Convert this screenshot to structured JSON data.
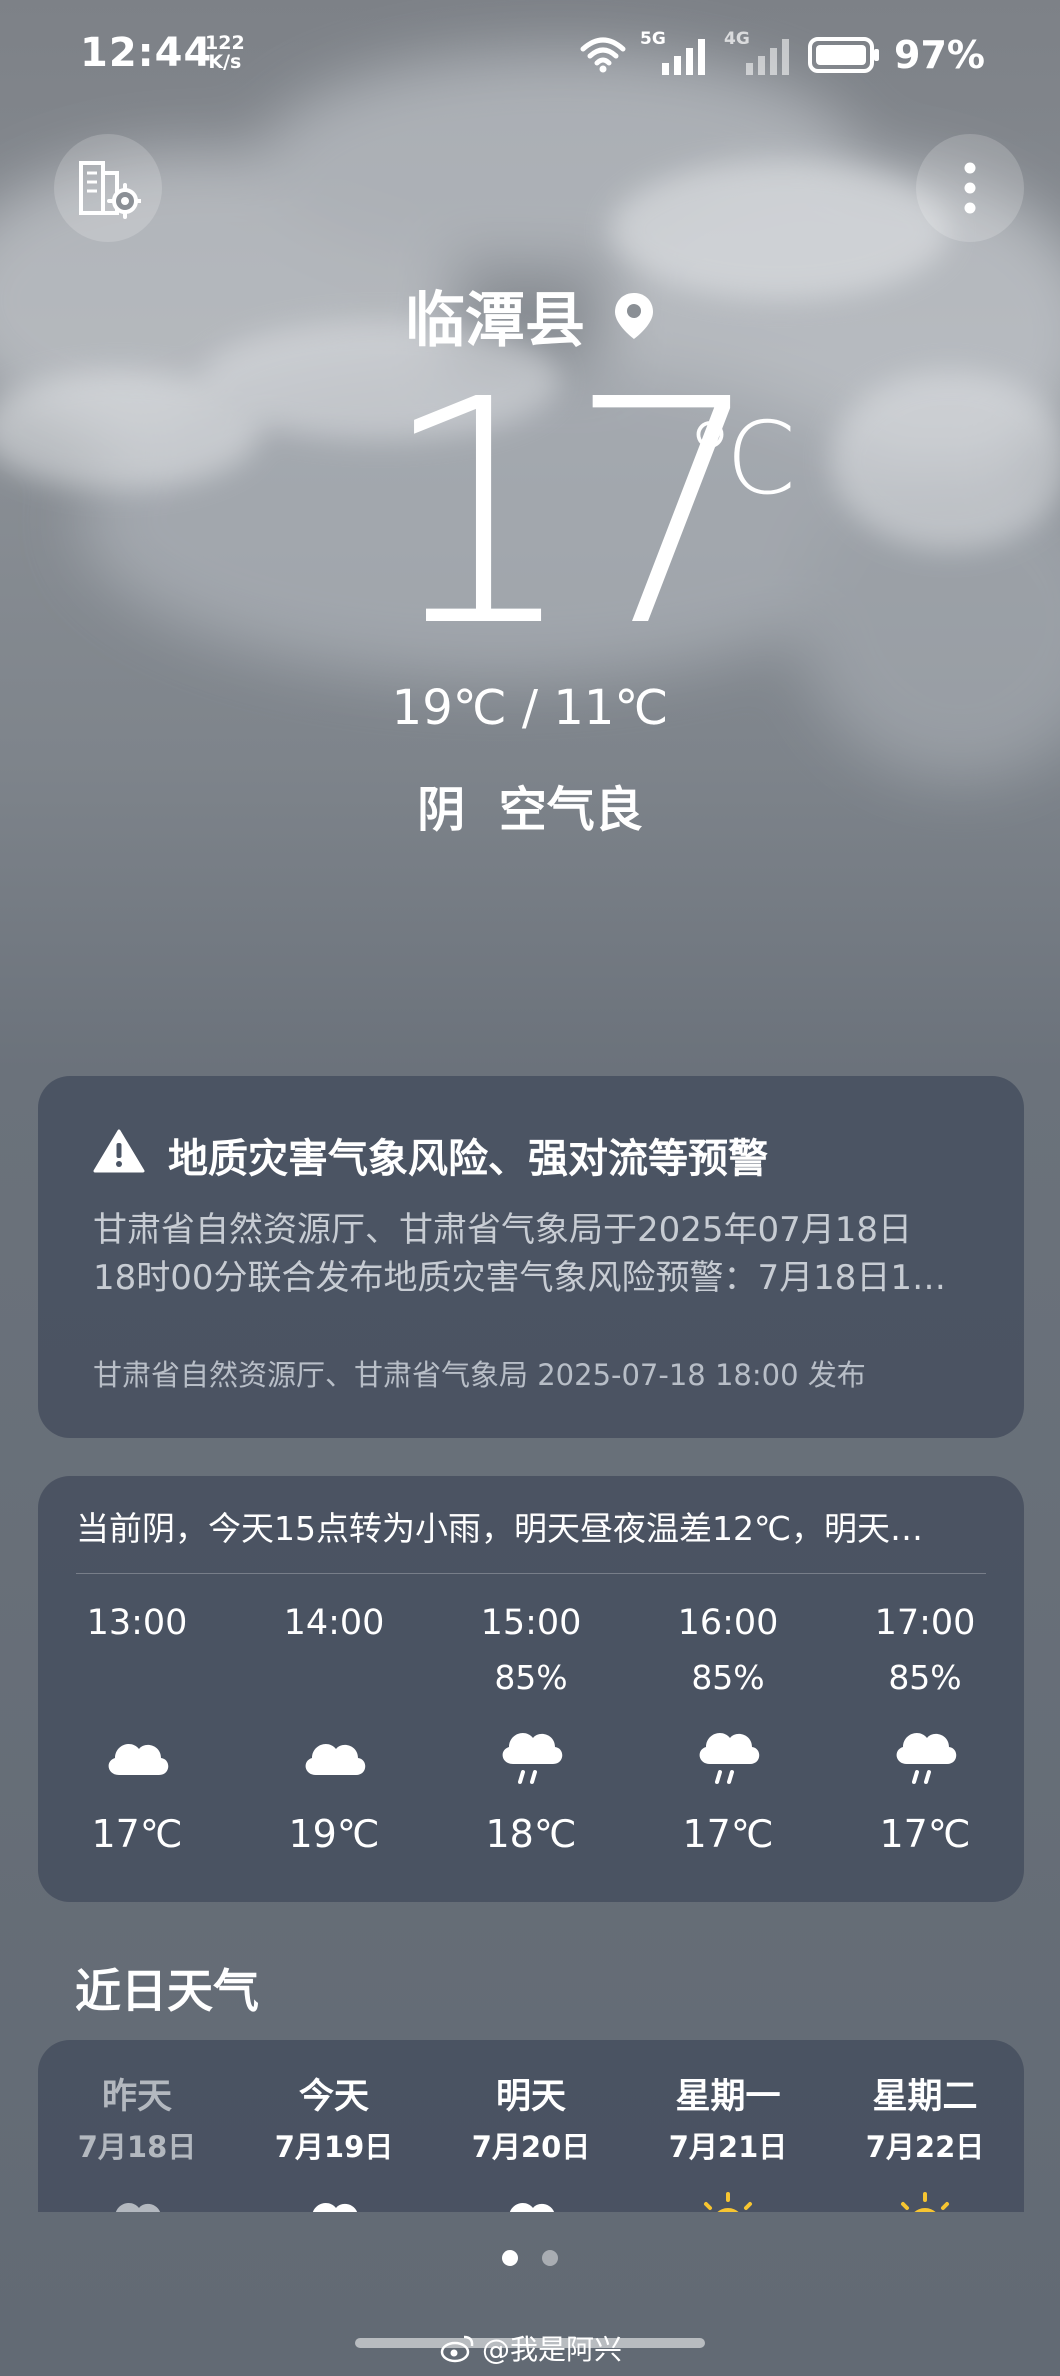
{
  "status_bar": {
    "time": "12:44",
    "net_speed_value": "122",
    "net_speed_unit": "K/s",
    "net1": "5G",
    "net2": "4G",
    "battery": "97%"
  },
  "header": {
    "city": "临潭县",
    "temperature": "17",
    "temp_unit": "℃",
    "high_low": "19℃ / 11℃",
    "condition": "阴  空气良",
    "icons": {
      "left": "city-management-icon",
      "right": "more-vertical-icon",
      "location": "location-pin-icon"
    }
  },
  "alert": {
    "title": "地质灾害气象风险、强对流等预警",
    "body_line1": "甘肃省自然资源厅、甘肃省气象局于2025年07月18日",
    "body_line2": "18时00分联合发布地质灾害气象风险预警：7月18日1…",
    "source": "甘肃省自然资源厅、甘肃省气象局 2025-07-18 18:00 发布"
  },
  "hourly": {
    "summary": "当前阴，今天15点转为小雨，明天昼夜温差12℃，明天…",
    "hours": [
      {
        "time": "13:00",
        "prob": "",
        "icon": "cloudy-icon",
        "temp": "17℃"
      },
      {
        "time": "14:00",
        "prob": "",
        "icon": "cloudy-icon",
        "temp": "19℃"
      },
      {
        "time": "15:00",
        "prob": "85%",
        "icon": "light-rain-icon",
        "temp": "18℃"
      },
      {
        "time": "16:00",
        "prob": "85%",
        "icon": "light-rain-icon",
        "temp": "17℃"
      },
      {
        "time": "17:00",
        "prob": "85%",
        "icon": "light-rain-icon",
        "temp": "17℃"
      }
    ]
  },
  "daily": {
    "title": "近日天气",
    "days": [
      {
        "name": "昨天",
        "date": "7月18日",
        "icon": "cloudy-icon"
      },
      {
        "name": "今天",
        "date": "7月19日",
        "icon": "cloudy-icon"
      },
      {
        "name": "明天",
        "date": "7月20日",
        "icon": "cloudy-icon"
      },
      {
        "name": "星期一",
        "date": "7月21日",
        "icon": "sunny-icon"
      },
      {
        "name": "星期二",
        "date": "7月22日",
        "icon": "sunny-icon"
      }
    ]
  },
  "pagination": {
    "pages": 2,
    "current": 1
  },
  "watermark": "@我是阿兴",
  "colors": {
    "card_bg": "#424c5c",
    "accent_sun": "#f7c531",
    "background": "#6b727b"
  }
}
